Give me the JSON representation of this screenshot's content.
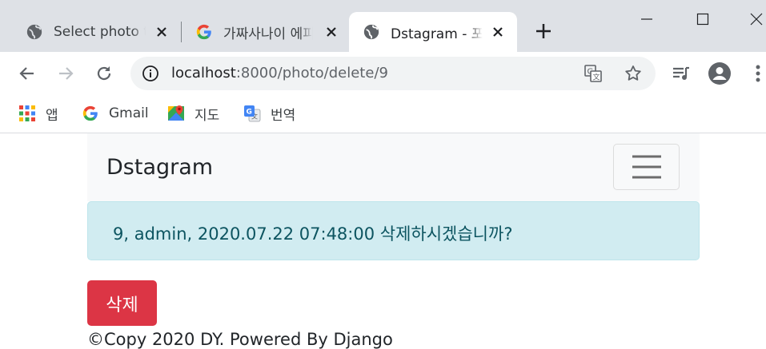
{
  "browser": {
    "tabs": [
      {
        "title": "Select photo to change",
        "active": false,
        "favicon": "globe-icon"
      },
      {
        "title": "가짜사나이 에피소드",
        "active": false,
        "favicon": "google-g-icon"
      },
      {
        "title": "Dstagram - 포토",
        "active": true,
        "favicon": "globe-icon"
      }
    ],
    "address": {
      "host": "localhost",
      "rest": ":8000/photo/delete/9"
    },
    "bookmarks": [
      {
        "label": "앱",
        "icon": "apps-grid-icon"
      },
      {
        "label": "Gmail",
        "icon": "google-g-icon"
      },
      {
        "label": "지도",
        "icon": "maps-icon"
      },
      {
        "label": "번역",
        "icon": "translate-icon"
      }
    ]
  },
  "page": {
    "brand": "Dstagram",
    "alert": "9, admin, 2020.07.22 07:48:00 삭제하시겠습니까?",
    "delete_label": "삭제",
    "footer": "©Copy 2020 DY. Powered By Django"
  },
  "colors": {
    "danger": "#dc3545",
    "alert_bg": "#d1ecf1",
    "alert_text": "#0c5460",
    "navbar_bg": "#f8f9fa"
  }
}
